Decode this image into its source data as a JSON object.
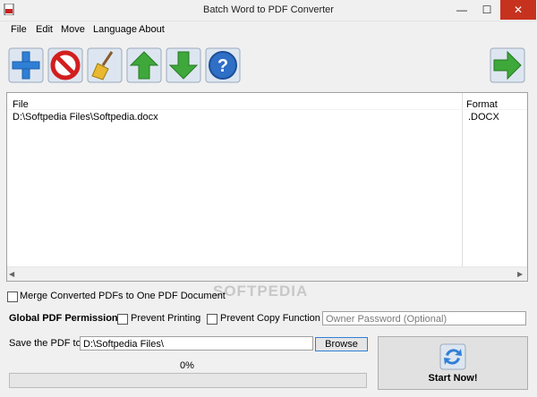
{
  "window": {
    "title": "Batch Word to PDF Converter",
    "minimize": "—",
    "maximize": "☐",
    "close": "✕"
  },
  "menu": [
    "File",
    "Edit",
    "Move",
    "Language",
    "About"
  ],
  "toolbar": {
    "icons": [
      "add-icon",
      "remove-icon",
      "clear-broom-icon",
      "move-up-icon",
      "move-down-icon",
      "help-icon",
      "next-icon"
    ]
  },
  "file_list": {
    "columns": [
      "File",
      "Format"
    ],
    "rows": [
      {
        "file": "D:\\Softpedia Files\\Softpedia.docx",
        "format": ".DOCX"
      }
    ]
  },
  "watermark": "SOFTPEDIA",
  "options": {
    "merge_label": "Merge Converted PDFs to One PDF Document",
    "permission_label": "Global PDF Permission:",
    "prevent_printing": "Prevent Printing",
    "prevent_copy": "Prevent Copy Function",
    "owner_password_placeholder": "Owner Password (Optional)"
  },
  "save": {
    "label": "Save the PDF to",
    "path": "D:\\Softpedia Files\\",
    "browse": "Browse"
  },
  "progress": {
    "text": "0%",
    "value": 0
  },
  "start": {
    "label": "Start Now!"
  },
  "colors": {
    "close_red": "#c7321f",
    "accent_blue": "#2f7fd6",
    "green": "#3fa83a"
  }
}
